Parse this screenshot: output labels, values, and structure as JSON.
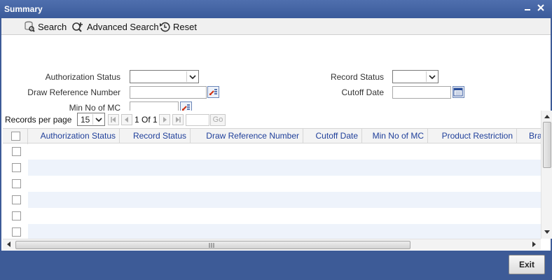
{
  "window": {
    "title": "Summary"
  },
  "toolbar": {
    "search_label": "Search",
    "advanced_search_label": "Advanced Search",
    "reset_label": "Reset"
  },
  "criteria": {
    "authorization_status": {
      "label": "Authorization Status",
      "value": ""
    },
    "draw_reference_number": {
      "label": "Draw Reference Number",
      "value": ""
    },
    "min_no_of_mc": {
      "label": "Min No of MC",
      "value": ""
    },
    "record_status": {
      "label": "Record Status",
      "value": ""
    },
    "cutoff_date": {
      "label": "Cutoff Date",
      "value": ""
    }
  },
  "pager": {
    "records_per_page_label": "Records per page",
    "records_per_page_value": "15",
    "page_info": "1 Of 1",
    "goto_value": "",
    "go_label": "Go"
  },
  "grid": {
    "columns": [
      "Authorization Status",
      "Record Status",
      "Draw Reference Number",
      "Cutoff Date",
      "Min No of MC",
      "Product Restriction",
      "Bra"
    ],
    "rows": 6
  },
  "footer": {
    "exit_label": "Exit"
  },
  "colors": {
    "header_blue": "#3d5b97",
    "column_text": "#1f3f9a"
  },
  "icons": [
    "search-icon",
    "advanced-search-icon",
    "reset-icon",
    "lov-icon",
    "calendar-icon",
    "minimize-icon",
    "close-icon"
  ]
}
